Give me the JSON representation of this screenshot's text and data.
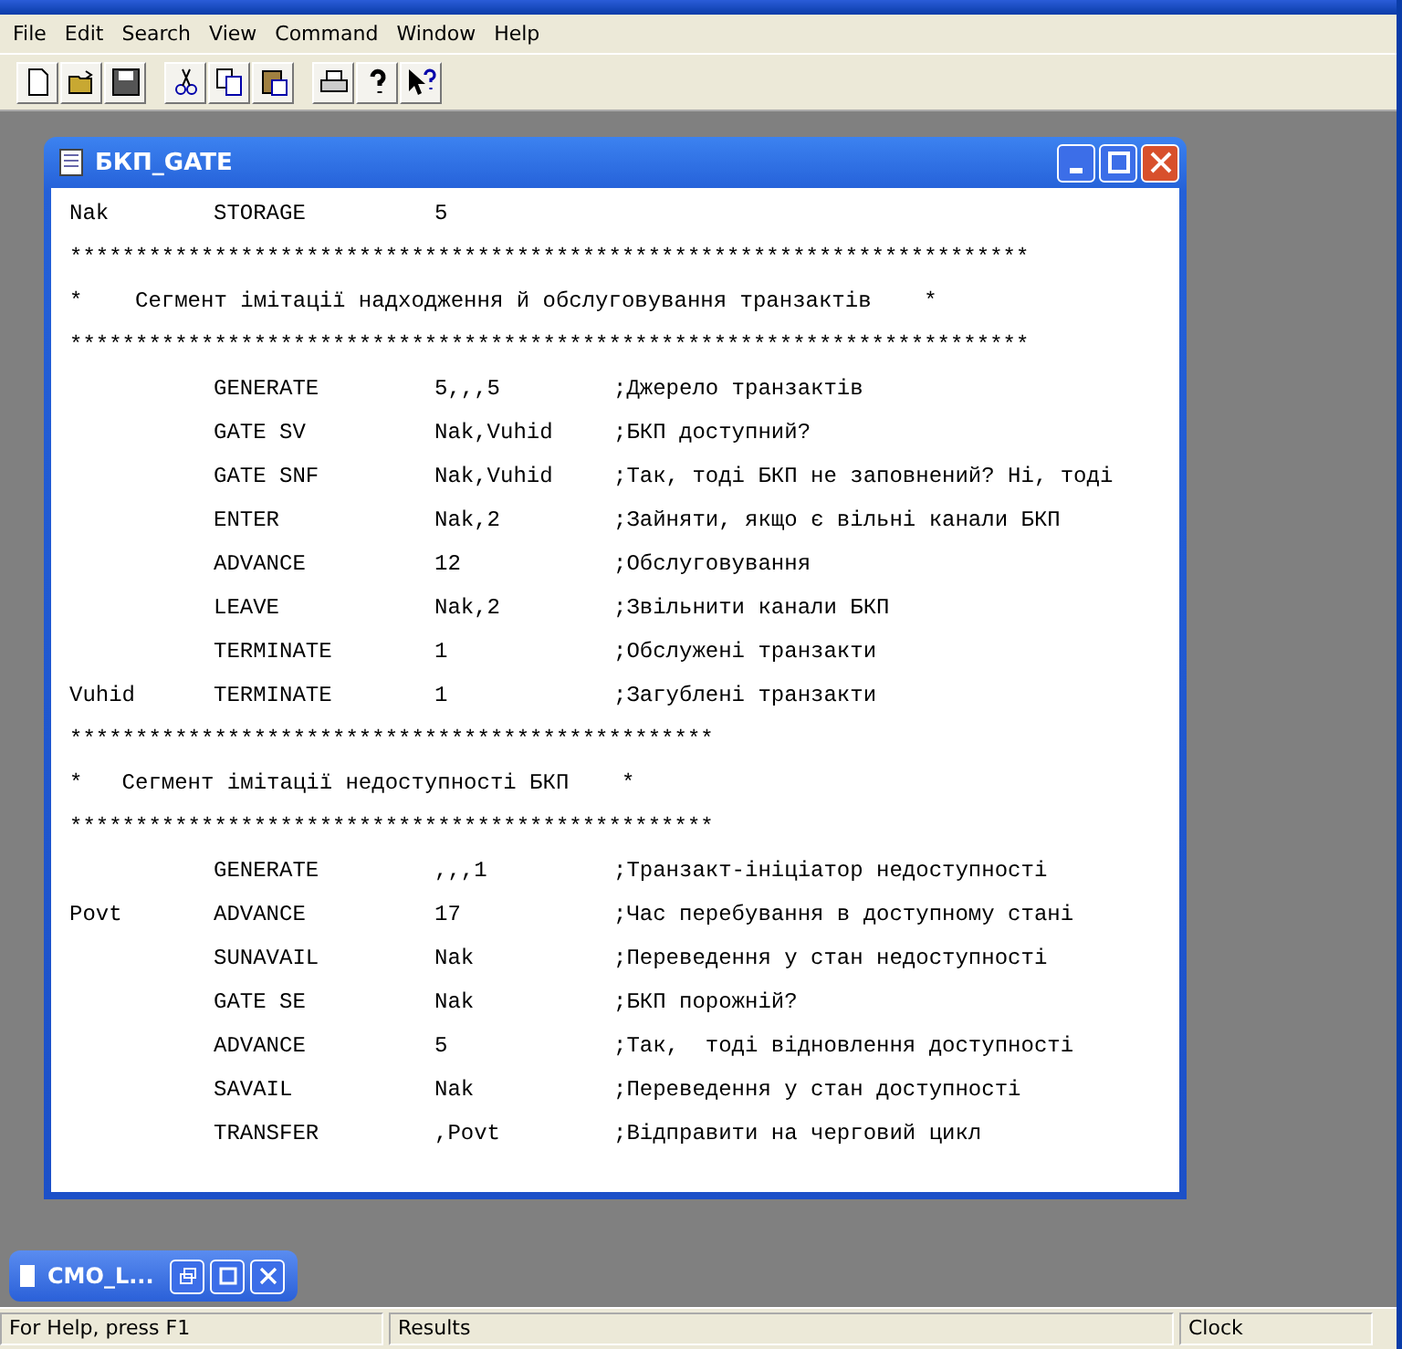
{
  "menu": [
    "File",
    "Edit",
    "Search",
    "View",
    "Command",
    "Window",
    "Help"
  ],
  "child_window": {
    "title": "БКП_GATE",
    "lines": [
      {
        "kind": "code",
        "label": "Nak",
        "op": "STORAGE",
        "operand": "5"
      },
      {
        "kind": "text",
        "text": "*************************************************************************"
      },
      {
        "kind": "text",
        "text": "*    Сегмент імітації надходження й обслуговування транзактів    *"
      },
      {
        "kind": "text",
        "text": "*************************************************************************"
      },
      {
        "kind": "code",
        "op": "GENERATE",
        "operand": "5,,,5",
        "comment": ";Джерело транзактів"
      },
      {
        "kind": "code",
        "op": "GATE SV",
        "operand": "Nak,Vuhid",
        "comment": ";БКП доступний?"
      },
      {
        "kind": "code",
        "op": "GATE SNF",
        "operand": "Nak,Vuhid",
        "comment": ";Так, тоді БКП не заповнений? Ні, тоді"
      },
      {
        "kind": "code",
        "op": "ENTER",
        "operand": "Nak,2",
        "comment": ";Зайняти, якщо є вільні канали БКП"
      },
      {
        "kind": "code",
        "op": "ADVANCE",
        "operand": "12",
        "comment": ";Обслуговування"
      },
      {
        "kind": "code",
        "op": "LEAVE",
        "operand": "Nak,2",
        "comment": ";Звільнити канали БКП"
      },
      {
        "kind": "code",
        "op": "TERMINATE",
        "operand": "1",
        "comment": ";Обслужені транзакти"
      },
      {
        "kind": "code",
        "label": "Vuhid",
        "op": "TERMINATE",
        "operand": "1",
        "comment": ";Загублені транзакти"
      },
      {
        "kind": "text",
        "text": "*************************************************"
      },
      {
        "kind": "text",
        "text": "*   Сегмент імітації недоступності БКП    *"
      },
      {
        "kind": "text",
        "text": "*************************************************"
      },
      {
        "kind": "code",
        "op": "GENERATE",
        "operand": ",,,1",
        "comment": ";Транзакт-ініціатор недоступності"
      },
      {
        "kind": "code",
        "label": "Povt",
        "op": "ADVANCE",
        "operand": "17",
        "comment": ";Час перебування в доступному стані"
      },
      {
        "kind": "code",
        "op": "SUNAVAIL",
        "operand": "Nak",
        "comment": ";Переведення у стан недоступності"
      },
      {
        "kind": "code",
        "op": "GATE SE",
        "operand": "Nak",
        "comment": ";БКП порожній?"
      },
      {
        "kind": "code",
        "op": "ADVANCE",
        "operand": "5",
        "comment": ";Так,  тоді відновлення доступності"
      },
      {
        "kind": "code",
        "op": "SAVAIL",
        "operand": "Nak",
        "comment": ";Переведення у стан доступності"
      },
      {
        "kind": "code",
        "op": "TRANSFER",
        "operand": ",Povt",
        "comment": ";Відправити на черговий цикл"
      }
    ]
  },
  "minimized_window": {
    "title": "CMO_L..."
  },
  "status_bar": [
    "For Help, press F1",
    "Results",
    "Clock"
  ]
}
